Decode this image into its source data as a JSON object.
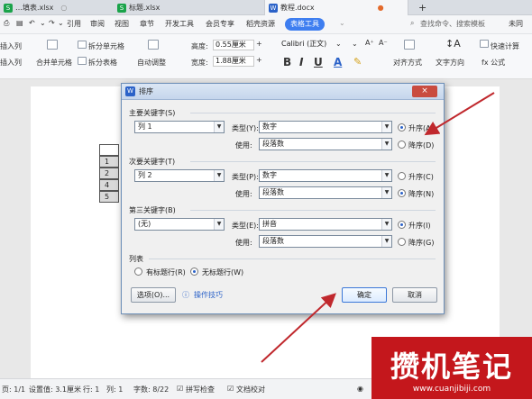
{
  "tabs": [
    {
      "label": "…填表.xlsx",
      "icon_color": "#1aa34a"
    },
    {
      "label": "标题.xlsx",
      "icon_color": "#1aa34a"
    },
    {
      "label": "教程.docx",
      "icon_color": "#2b62c8"
    }
  ],
  "tab_add": "+",
  "menu": {
    "items": [
      "引用",
      "审阅",
      "视图",
      "章节",
      "开发工具",
      "会员专享",
      "稻壳资源"
    ],
    "highlight": "表格工具",
    "search": "查找命令、搜索模板",
    "right": "未同"
  },
  "ribbon": {
    "insert_col_1": "插入列",
    "insert_col_2": "插入列",
    "merge_cells": "合并单元格",
    "split_cells": "拆分单元格",
    "split_table": "拆分表格",
    "auto_fit": "自动调整",
    "height_label": "高度:",
    "height_value": "0.55厘米",
    "width_label": "宽度:",
    "width_value": "1.88厘米",
    "font_name": "Calibri (正文)",
    "align": "对齐方式",
    "text_dir": "文字方向",
    "quick_calc": "快速计算",
    "formula": "fx 公式",
    "bold": "B",
    "italic": "I",
    "underline": "U",
    "font_color": "A"
  },
  "document": {
    "rows": [
      "1",
      "2",
      "4",
      "5"
    ]
  },
  "dialog": {
    "title": "排序",
    "primary": {
      "group": "主要关键字(S)",
      "key": "列 1",
      "type_label": "类型(Y):",
      "type": "数字",
      "use_label": "使用:",
      "use": "段落数",
      "asc": "升序(A)",
      "desc": "降序(D)",
      "selected": "asc"
    },
    "secondary": {
      "group": "次要关键字(T)",
      "key": "列 2",
      "type_label": "类型(P):",
      "type": "数字",
      "use_label": "使用:",
      "use": "段落数",
      "asc": "升序(C)",
      "desc": "降序(N)",
      "selected": "desc"
    },
    "third": {
      "group": "第三关键字(B)",
      "key": "(无)",
      "type_label": "类型(E):",
      "type": "拼音",
      "use_label": "使用:",
      "use": "段落数",
      "asc": "升序(I)",
      "desc": "降序(G)",
      "selected": "asc"
    },
    "list": {
      "group": "列表",
      "has_header": "有标题行(R)",
      "no_header": "无标题行(W)",
      "selected": "no_header"
    },
    "options_button": "选项(O)...",
    "tips": "操作技巧",
    "ok": "确定",
    "cancel": "取消",
    "close": "×"
  },
  "status": {
    "page": "页: 1/1",
    "setting": "设置值: 3.1厘米",
    "row": "行: 1",
    "col": "列: 1",
    "words": "字数: 8/22",
    "spell": "拼写检查",
    "doc_check": "文档校对"
  },
  "watermark": {
    "text": "攒机笔记",
    "url": "www.cuanjibiji.com"
  },
  "colors": {
    "accent": "#3e7ef0",
    "arrow": "#c0282d",
    "watermark_bg": "#c4171c"
  }
}
